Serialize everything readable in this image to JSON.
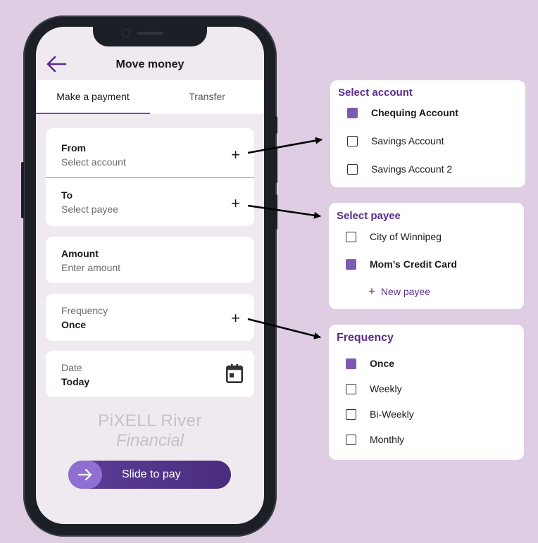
{
  "app": {
    "title": "Move money",
    "tabs": [
      {
        "label": "Make a payment",
        "active": true
      },
      {
        "label": "Transfer",
        "active": false
      }
    ]
  },
  "form": {
    "from": {
      "label": "From",
      "placeholder": "Select account"
    },
    "to": {
      "label": "To",
      "placeholder": "Select payee"
    },
    "amount": {
      "label": "Amount",
      "placeholder": "Enter amount"
    },
    "frequency": {
      "label": "Frequency",
      "value": "Once"
    },
    "date": {
      "label": "Date",
      "value": "Today"
    }
  },
  "logo": {
    "line1": "PiXELL River",
    "line2": "Financial"
  },
  "slide_button": {
    "label": "Slide to pay"
  },
  "panels": {
    "select_account": {
      "title": "Select account",
      "options": [
        {
          "label": "Chequing Account",
          "checked": true
        },
        {
          "label": "Savings Account",
          "checked": false
        },
        {
          "label": "Savings Account 2",
          "checked": false
        }
      ]
    },
    "select_payee": {
      "title": "Select payee",
      "options": [
        {
          "label": "City of Winnipeg",
          "checked": false
        },
        {
          "label": "Mom’s Credit Card",
          "checked": true
        }
      ],
      "new_payee": "New payee"
    },
    "frequency": {
      "title": "Frequency",
      "options": [
        {
          "label": "Once",
          "checked": true
        },
        {
          "label": "Weekly",
          "checked": false
        },
        {
          "label": "Bi-Weekly",
          "checked": false
        },
        {
          "label": "Monthly",
          "checked": false
        }
      ]
    }
  },
  "icons": {
    "back": "arrow-left-icon",
    "plus": "plus-icon",
    "calendar": "calendar-icon",
    "slide": "arrow-right-icon"
  },
  "colors": {
    "background": "#dfcde3",
    "accent": "#5b2d8c",
    "checkbox_checked": "#7b5aaf",
    "slide_button": "#5c3d99",
    "slide_knob": "#8f6fd1"
  }
}
